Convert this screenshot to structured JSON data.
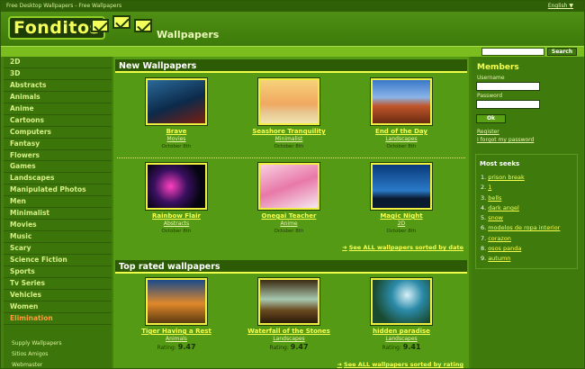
{
  "topbar": {
    "title": "Free Desktop Wallpapers - Free Wallpapers",
    "language": "English ▼"
  },
  "header": {
    "logo_text": "Fonditos",
    "section_title": "Wallpapers"
  },
  "search": {
    "button_label": "Search",
    "placeholder": ""
  },
  "sidebar": {
    "categories": [
      "2D",
      "3D",
      "Abstracts",
      "Animals",
      "Anime",
      "Cartoons",
      "Computers",
      "Fantasy",
      "Flowers",
      "Games",
      "Landscapes",
      "Manipulated Photos",
      "Men",
      "Minimalist",
      "Movies",
      "Music",
      "Scary",
      "Science Fiction",
      "Sports",
      "Tv Series",
      "Vehicles",
      "Women",
      "Elimination"
    ],
    "links": [
      "Supply Wallpapers",
      "Sitios Amigos",
      "Webmaster"
    ]
  },
  "new_wallpapers": {
    "title": "New Wallpapers",
    "items": [
      {
        "name": "Brave",
        "category": "Movies",
        "date": "October 8th"
      },
      {
        "name": "Seashore Tranquility",
        "category": "Minimalist",
        "date": "October 8th"
      },
      {
        "name": "End of the Day",
        "category": "Landscapes",
        "date": "October 8th"
      },
      {
        "name": "Rainbow Flair",
        "category": "Abstracts",
        "date": "October 8th"
      },
      {
        "name": "Onegai Teacher",
        "category": "Anime",
        "date": "October 8th"
      },
      {
        "name": "Magic Night",
        "category": "2D",
        "date": "October 8th"
      }
    ],
    "see_all": "See ALL wallpapers sorted by date"
  },
  "top_rated": {
    "title": "Top rated wallpapers",
    "rating_label": "Rating:",
    "items": [
      {
        "name": "Tiger Having a Rest",
        "category": "Animals",
        "rating": "9.47"
      },
      {
        "name": "Waterfall of the Stones",
        "category": "Landscapes",
        "rating": "9.47"
      },
      {
        "name": "hidden paradise",
        "category": "Landscapes",
        "rating": "9.41"
      }
    ],
    "see_all": "See ALL wallpapers sorted by rating"
  },
  "members": {
    "title": "Members",
    "username_label": "Username",
    "password_label": "Password",
    "ok_label": "Ok",
    "register": "Register",
    "forgot": "I forgot my password"
  },
  "most_seeks": {
    "title": "Most seeks",
    "items": [
      "prison break",
      "1",
      "bells",
      "dark angel",
      "snow",
      "modelos de ropa interior",
      "corazon",
      "osos panda",
      "autumn"
    ]
  },
  "colors": {
    "accent_yellow": "#f6ff50",
    "dark_green": "#2c5a05",
    "elimination": "#ff9a3c"
  }
}
